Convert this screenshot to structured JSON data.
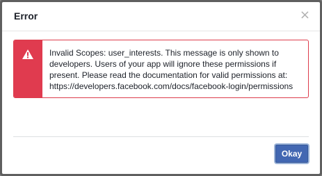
{
  "dialog": {
    "title": "Error",
    "close_glyph": "×",
    "alert": {
      "icon": "warning-triangle-icon",
      "message": "Invalid Scopes: user_interests. This message is only shown to developers. Users of your app will ignore these permissions if present. Please read the documentation for valid permissions at: https://developers.facebook.com/docs/facebook-login/permissions"
    },
    "okay_label": "Okay"
  },
  "colors": {
    "alert_accent": "#e03b4f",
    "button_primary": "#4267b2"
  }
}
